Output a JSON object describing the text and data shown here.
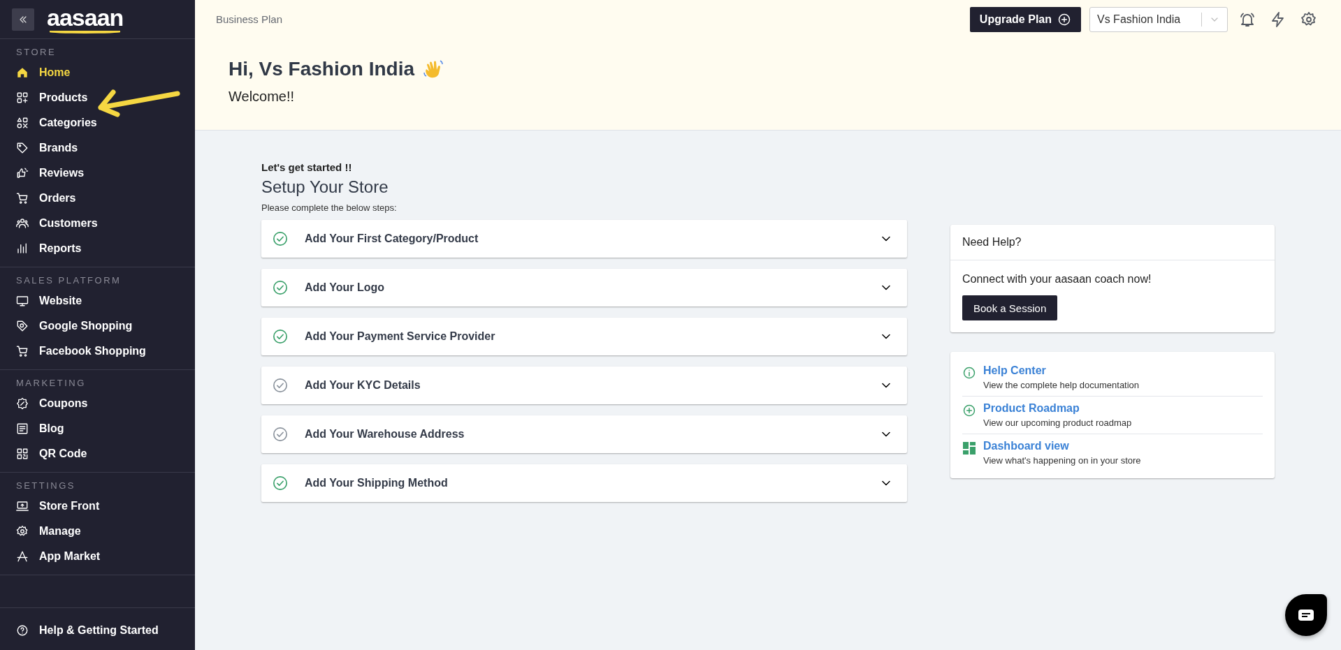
{
  "sidebar": {
    "logo": "aasaan",
    "sections": [
      {
        "label": "STORE",
        "items": [
          {
            "label": "Home",
            "selected": true
          },
          {
            "label": "Products",
            "selected": false
          },
          {
            "label": "Categories",
            "selected": false
          },
          {
            "label": "Brands",
            "selected": false
          },
          {
            "label": "Reviews",
            "selected": false
          },
          {
            "label": "Orders",
            "selected": false
          },
          {
            "label": "Customers",
            "selected": false
          },
          {
            "label": "Reports",
            "selected": false
          }
        ]
      },
      {
        "label": "SALES PLATFORM",
        "items": [
          {
            "label": "Website",
            "selected": false
          },
          {
            "label": "Google Shopping",
            "selected": false
          },
          {
            "label": "Facebook Shopping",
            "selected": false
          }
        ]
      },
      {
        "label": "MARKETING",
        "items": [
          {
            "label": "Coupons",
            "selected": false
          },
          {
            "label": "Blog",
            "selected": false
          },
          {
            "label": "QR Code",
            "selected": false
          }
        ]
      },
      {
        "label": "SETTINGS",
        "items": [
          {
            "label": "Store Front",
            "selected": false
          },
          {
            "label": "Manage",
            "selected": false
          },
          {
            "label": "App Market",
            "selected": false
          }
        ]
      }
    ],
    "footer": "Help & Getting Started"
  },
  "topbar": {
    "plan": "Business Plan",
    "upgrade_button": "Upgrade Plan",
    "store_select": "Vs Fashion India"
  },
  "greeting": {
    "title": "Hi, Vs Fashion India",
    "subtitle": "Welcome!!"
  },
  "setup": {
    "kicker": "Let's get started !!",
    "title": "Setup Your Store",
    "hint": "Please complete the below steps:",
    "steps": [
      {
        "label": "Add Your First Category/Product",
        "done": true
      },
      {
        "label": "Add Your Logo",
        "done": true
      },
      {
        "label": "Add Your Payment Service Provider",
        "done": true
      },
      {
        "label": "Add Your KYC Details",
        "done": false
      },
      {
        "label": "Add Your Warehouse Address",
        "done": false
      },
      {
        "label": "Add Your Shipping Method",
        "done": true
      }
    ]
  },
  "help": {
    "title": "Need Help?",
    "text": "Connect with your aasaan coach now!",
    "button": "Book a Session",
    "links": [
      {
        "kind": "info",
        "title": "Help Center",
        "description": "View the complete help documentation"
      },
      {
        "kind": "plus",
        "title": "Product Roadmap",
        "description": "View our upcoming product roadmap"
      },
      {
        "kind": "grid",
        "title": "Dashboard view",
        "description": "View what's happening on in your store"
      }
    ]
  }
}
